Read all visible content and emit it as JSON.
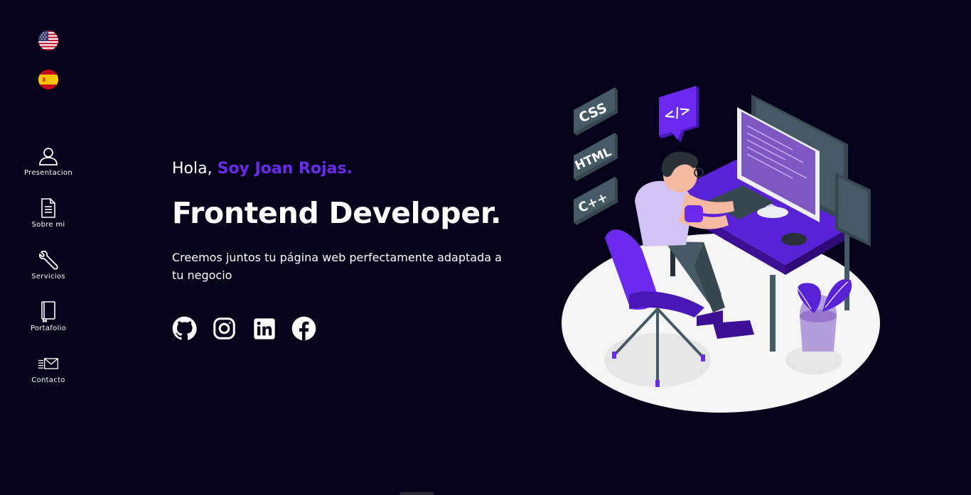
{
  "languages": [
    {
      "code": "en",
      "icon": "us-flag-icon"
    },
    {
      "code": "es",
      "icon": "spain-flag-icon"
    }
  ],
  "nav": {
    "items": [
      {
        "label": "Presentacion",
        "icon": "user-icon"
      },
      {
        "label": "Sobre mi",
        "icon": "document-icon"
      },
      {
        "label": "Servicios",
        "icon": "wrench-icon"
      },
      {
        "label": "Portafolio",
        "icon": "book-icon"
      },
      {
        "label": "Contacto",
        "icon": "mail-icon"
      }
    ]
  },
  "hero": {
    "greeting": "Hola,",
    "name": "Soy Joan Rojas.",
    "headline": "Frontend Developer.",
    "tagline": "Creemos juntos tu página web perfectamente adaptada a tu negocio"
  },
  "socials": [
    {
      "icon": "github-icon"
    },
    {
      "icon": "instagram-icon"
    },
    {
      "icon": "linkedin-icon"
    },
    {
      "icon": "facebook-icon"
    }
  ],
  "illustration": {
    "badges": [
      "CSS",
      "HTML",
      "C++"
    ],
    "code_badge": "</>"
  },
  "colors": {
    "background": "#05011a",
    "accent": "#6b2af0",
    "text": "#ffffff"
  }
}
